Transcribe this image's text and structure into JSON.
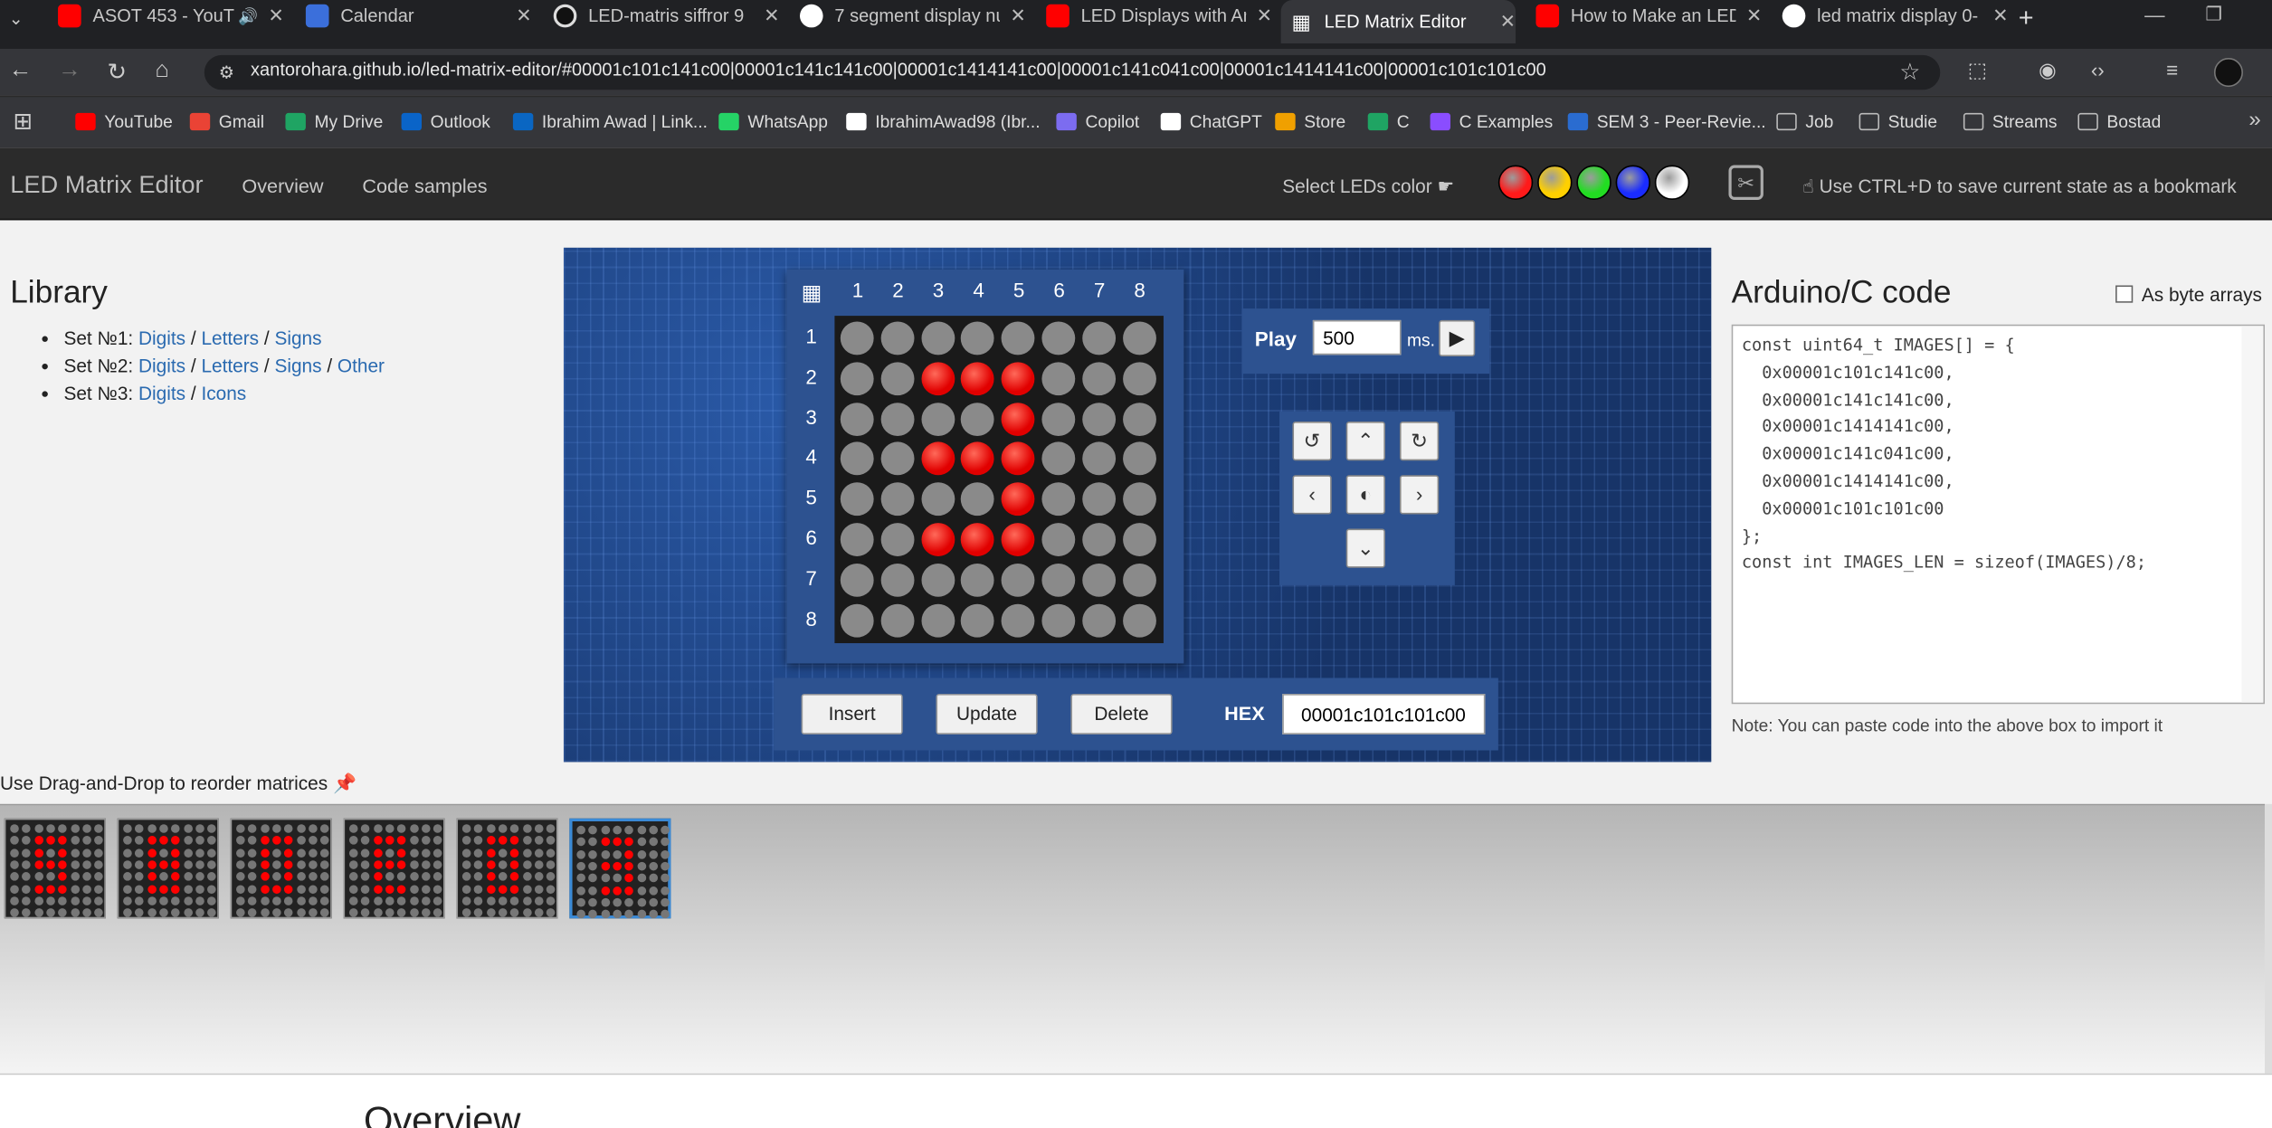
{
  "browser": {
    "tabs": [
      {
        "title": "ASOT 453 - YouT",
        "favicon": "youtube-icon",
        "audio": true
      },
      {
        "title": "Calendar",
        "favicon": "calendar-icon"
      },
      {
        "title": "LED-matris siffror 9",
        "favicon": "chatgpt-icon"
      },
      {
        "title": "7 segment display nu",
        "favicon": "google-icon"
      },
      {
        "title": "LED Displays with Ar",
        "favicon": "youtube-icon"
      },
      {
        "title": "LED Matrix Editor",
        "favicon": "grid-icon",
        "active": true
      },
      {
        "title": "How to Make an LED",
        "favicon": "youtube-icon"
      },
      {
        "title": "led matrix display 0-",
        "favicon": "google-icon"
      }
    ],
    "url": "xantorohara.github.io/led-matrix-editor/#00001c101c141c00|00001c141c141c00|00001c1414141c00|00001c141c041c00|00001c1414141c00|00001c101c101c00",
    "bookmarks": [
      "YouTube",
      "Gmail",
      "My Drive",
      "Outlook",
      "Ibrahim Awad | Link...",
      "WhatsApp",
      "IbrahimAwad98 (Ibr...",
      "Copilot",
      "ChatGPT",
      "Store",
      "C",
      "C Examples",
      "SEM 3 - Peer-Revie...",
      "Job",
      "Studie",
      "Streams",
      "Bostad"
    ]
  },
  "app": {
    "brand": "LED Matrix Editor",
    "nav": [
      "Overview",
      "Code samples"
    ],
    "select_color_label": "Select LEDs color",
    "led_colors": [
      "#ff1a1a",
      "#ffd000",
      "#22dd22",
      "#1a2cff",
      "#ffffff"
    ],
    "bookmark_hint": "Use CTRL+D to save current state as a bookmark"
  },
  "library": {
    "title": "Library",
    "sets": [
      {
        "name": "Set №1:",
        "links": [
          "Digits",
          "Letters",
          "Signs"
        ]
      },
      {
        "name": "Set №2:",
        "links": [
          "Digits",
          "Letters",
          "Signs",
          "Other"
        ]
      },
      {
        "name": "Set №3:",
        "links": [
          "Digits",
          "Icons"
        ]
      }
    ]
  },
  "editor": {
    "columns": [
      "1",
      "2",
      "3",
      "4",
      "5",
      "6",
      "7",
      "8"
    ],
    "rows": [
      "1",
      "2",
      "3",
      "4",
      "5",
      "6",
      "7",
      "8"
    ],
    "matrix": [
      [
        0,
        0,
        0,
        0,
        0,
        0,
        0,
        0
      ],
      [
        0,
        0,
        1,
        1,
        1,
        0,
        0,
        0
      ],
      [
        0,
        0,
        0,
        0,
        1,
        0,
        0,
        0
      ],
      [
        0,
        0,
        1,
        1,
        1,
        0,
        0,
        0
      ],
      [
        0,
        0,
        0,
        0,
        1,
        0,
        0,
        0
      ],
      [
        0,
        0,
        1,
        1,
        1,
        0,
        0,
        0
      ],
      [
        0,
        0,
        0,
        0,
        0,
        0,
        0,
        0
      ],
      [
        0,
        0,
        0,
        0,
        0,
        0,
        0,
        0
      ]
    ],
    "play_label": "Play",
    "interval": "500",
    "interval_unit": "ms.",
    "insert_label": "Insert",
    "update_label": "Update",
    "delete_label": "Delete",
    "hex_label": "HEX",
    "hex_value": "00001c101c101c00"
  },
  "code": {
    "title": "Arduino/C code",
    "byte_arrays_label": "As byte arrays",
    "text": "const uint64_t IMAGES[] = {\n  0x00001c101c141c00,\n  0x00001c141c141c00,\n  0x00001c1414141c00,\n  0x00001c141c041c00,\n  0x00001c1414141c00,\n  0x00001c101c101c00\n};\nconst int IMAGES_LEN = sizeof(IMAGES)/8;",
    "note": "Note: You can paste code into the above box to import it"
  },
  "reorder": {
    "hint": "Use Drag-and-Drop to reorder matrices",
    "selected_index": 5,
    "frames": [
      [
        [
          0,
          0,
          0,
          0,
          0,
          0,
          0,
          0
        ],
        [
          0,
          0,
          1,
          1,
          1,
          0,
          0,
          0
        ],
        [
          0,
          0,
          1,
          0,
          1,
          0,
          0,
          0
        ],
        [
          0,
          0,
          1,
          1,
          1,
          0,
          0,
          0
        ],
        [
          0,
          0,
          0,
          0,
          1,
          0,
          0,
          0
        ],
        [
          0,
          0,
          1,
          1,
          1,
          0,
          0,
          0
        ],
        [
          0,
          0,
          0,
          0,
          0,
          0,
          0,
          0
        ],
        [
          0,
          0,
          0,
          0,
          0,
          0,
          0,
          0
        ]
      ],
      [
        [
          0,
          0,
          0,
          0,
          0,
          0,
          0,
          0
        ],
        [
          0,
          0,
          1,
          1,
          1,
          0,
          0,
          0
        ],
        [
          0,
          0,
          1,
          0,
          1,
          0,
          0,
          0
        ],
        [
          0,
          0,
          1,
          1,
          1,
          0,
          0,
          0
        ],
        [
          0,
          0,
          1,
          0,
          1,
          0,
          0,
          0
        ],
        [
          0,
          0,
          1,
          1,
          1,
          0,
          0,
          0
        ],
        [
          0,
          0,
          0,
          0,
          0,
          0,
          0,
          0
        ],
        [
          0,
          0,
          0,
          0,
          0,
          0,
          0,
          0
        ]
      ],
      [
        [
          0,
          0,
          0,
          0,
          0,
          0,
          0,
          0
        ],
        [
          0,
          0,
          1,
          1,
          1,
          0,
          0,
          0
        ],
        [
          0,
          0,
          1,
          0,
          1,
          0,
          0,
          0
        ],
        [
          0,
          0,
          1,
          0,
          1,
          0,
          0,
          0
        ],
        [
          0,
          0,
          1,
          0,
          1,
          0,
          0,
          0
        ],
        [
          0,
          0,
          1,
          1,
          1,
          0,
          0,
          0
        ],
        [
          0,
          0,
          0,
          0,
          0,
          0,
          0,
          0
        ],
        [
          0,
          0,
          0,
          0,
          0,
          0,
          0,
          0
        ]
      ],
      [
        [
          0,
          0,
          0,
          0,
          0,
          0,
          0,
          0
        ],
        [
          0,
          0,
          1,
          1,
          1,
          0,
          0,
          0
        ],
        [
          0,
          0,
          1,
          0,
          1,
          0,
          0,
          0
        ],
        [
          0,
          0,
          1,
          1,
          1,
          0,
          0,
          0
        ],
        [
          0,
          0,
          1,
          0,
          0,
          0,
          0,
          0
        ],
        [
          0,
          0,
          1,
          1,
          1,
          0,
          0,
          0
        ],
        [
          0,
          0,
          0,
          0,
          0,
          0,
          0,
          0
        ],
        [
          0,
          0,
          0,
          0,
          0,
          0,
          0,
          0
        ]
      ],
      [
        [
          0,
          0,
          0,
          0,
          0,
          0,
          0,
          0
        ],
        [
          0,
          0,
          1,
          1,
          1,
          0,
          0,
          0
        ],
        [
          0,
          0,
          1,
          0,
          1,
          0,
          0,
          0
        ],
        [
          0,
          0,
          1,
          0,
          1,
          0,
          0,
          0
        ],
        [
          0,
          0,
          1,
          0,
          1,
          0,
          0,
          0
        ],
        [
          0,
          0,
          1,
          1,
          1,
          0,
          0,
          0
        ],
        [
          0,
          0,
          0,
          0,
          0,
          0,
          0,
          0
        ],
        [
          0,
          0,
          0,
          0,
          0,
          0,
          0,
          0
        ]
      ],
      [
        [
          0,
          0,
          0,
          0,
          0,
          0,
          0,
          0
        ],
        [
          0,
          0,
          1,
          1,
          1,
          0,
          0,
          0
        ],
        [
          0,
          0,
          0,
          0,
          1,
          0,
          0,
          0
        ],
        [
          0,
          0,
          1,
          1,
          1,
          0,
          0,
          0
        ],
        [
          0,
          0,
          0,
          0,
          1,
          0,
          0,
          0
        ],
        [
          0,
          0,
          1,
          1,
          1,
          0,
          0,
          0
        ],
        [
          0,
          0,
          0,
          0,
          0,
          0,
          0,
          0
        ],
        [
          0,
          0,
          0,
          0,
          0,
          0,
          0,
          0
        ]
      ]
    ]
  },
  "overview_title": "Overview"
}
